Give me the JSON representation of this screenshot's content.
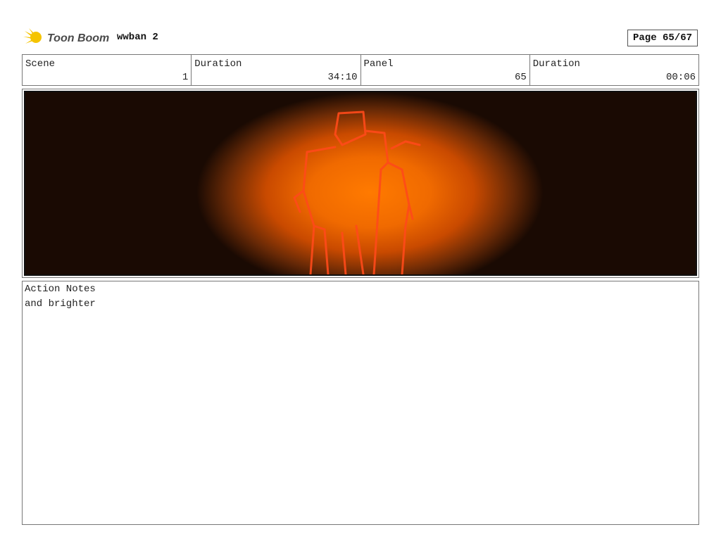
{
  "header": {
    "logo_text": "Toon Boom",
    "project_title": "wwban 2",
    "page_label": "Page 65/67"
  },
  "info": [
    {
      "label": "Scene",
      "value": "1"
    },
    {
      "label": "Duration",
      "value": "34:10"
    },
    {
      "label": "Panel",
      "value": "65"
    },
    {
      "label": "Duration",
      "value": "00:06"
    }
  ],
  "notes": {
    "label": "Action Notes",
    "text": "and brighter"
  },
  "colors": {
    "glow_center": "#ff7a00",
    "glow_mid": "#c94a00",
    "glow_edge": "#1a0a03",
    "sketch_line": "#ff4a1a",
    "logo_yellow": "#f5c400",
    "logo_text": "#4a4a4a"
  }
}
